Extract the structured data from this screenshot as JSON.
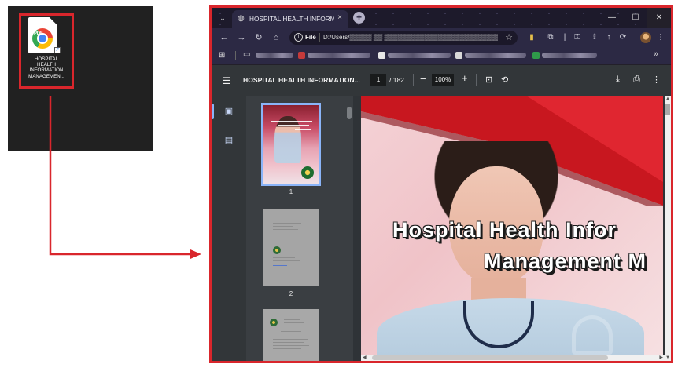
{
  "desktop": {
    "file_icon": "chrome-pdf-file-icon",
    "file_badge": "PDF",
    "file_label_lines": [
      "HOSPITAL",
      "HEALTH",
      "INFORMATION",
      "MANAGEMEN..."
    ]
  },
  "browser": {
    "tab_title": "HOSPITAL HEALTH INFORMATIO",
    "tab_close": "×",
    "new_tab": "+",
    "window_controls": {
      "minimize": "—",
      "maximize": "☐",
      "close": "✕"
    },
    "address": {
      "scheme": "File",
      "url": "D:/Users/▒▒▒▒▒ ▒▒ ▒▒▒▒▒▒▒▒▒▒▒▒▒▒▒▒▒▒▒▒▒▒▒▒▒▒▒▒▒▒▒ ▒"
    }
  },
  "pdf_viewer": {
    "doc_title": "HOSPITAL HEALTH INFORMATION...",
    "current_page": "1",
    "total_pages": "/ 182",
    "zoom": "100%",
    "thumbnails": [
      {
        "page": "1"
      },
      {
        "page": "2"
      }
    ],
    "cover_title_line1": "Hospital Health Infor",
    "cover_title_line2": "Management M"
  },
  "colors": {
    "annotation_red": "#d9262c",
    "titlebar": "#1d1a2b",
    "pdf_toolbar": "#323639",
    "accent_blue": "#8ab4f8"
  }
}
